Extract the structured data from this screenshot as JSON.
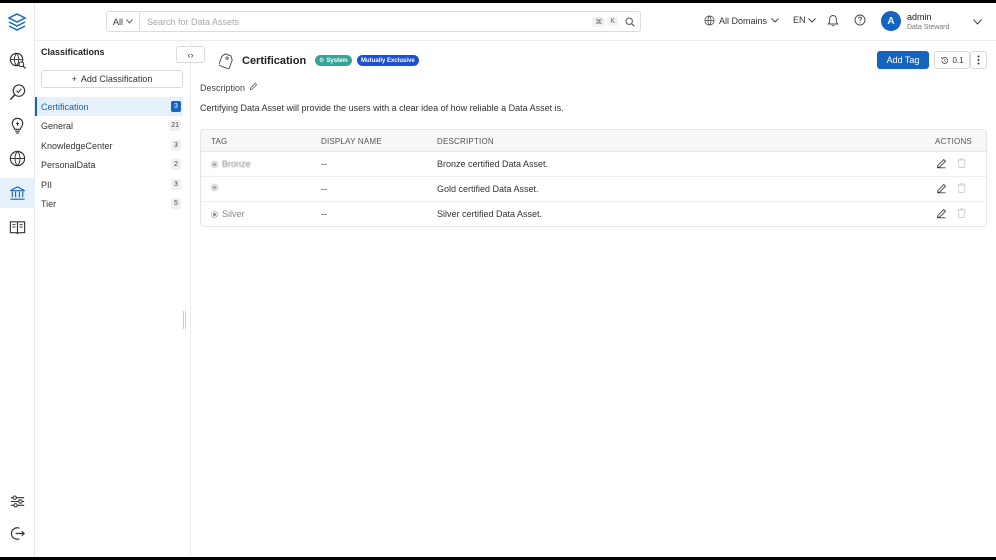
{
  "topbar": {
    "search_scope": "All",
    "search_placeholder": "Search for Data Assets",
    "shortcut_key_1": "⌘",
    "shortcut_key_2": "K",
    "domains_label": "All Domains",
    "language": "EN",
    "user": {
      "initial": "A",
      "name": "admin",
      "role": "Data Steward"
    }
  },
  "panel": {
    "title": "Classifications",
    "add_button": "Add Classification",
    "items": [
      {
        "label": "Certification",
        "count": "3",
        "active": true
      },
      {
        "label": "General",
        "count": "21"
      },
      {
        "label": "KnowledgeCenter",
        "count": "3"
      },
      {
        "label": "PersonalData",
        "count": "2"
      },
      {
        "label": "PII",
        "count": "3"
      },
      {
        "label": "Tier",
        "count": "5"
      }
    ]
  },
  "main": {
    "title": "Certification",
    "badge_system": "System",
    "badge_exclusive": "Mutually Exclusive",
    "add_tag_label": "Add Tag",
    "version": "0.1",
    "description_label": "Description",
    "description_text": "Certifying Data Asset will provide the users with a clear idea of how reliable a Data Asset is.",
    "columns": [
      "TAG",
      "DISPLAY NAME",
      "DESCRIPTION",
      "ACTIONS"
    ],
    "rows": [
      {
        "tag": "Bronze",
        "display_name": "--",
        "description": "Bronze certified Data Asset."
      },
      {
        "tag": "",
        "display_name": "--",
        "description": "Gold certified Data Asset."
      },
      {
        "tag": "Silver",
        "display_name": "--",
        "description": "Silver certified Data Asset."
      }
    ]
  },
  "colors": {
    "primary": "#1565c0",
    "system_badge": "#3aa399",
    "exclusive_badge": "#1d4fd1",
    "active_bg": "#e6f0fb"
  },
  "icons": {
    "rail": [
      "logo-icon",
      "explore-icon",
      "data-quality-icon",
      "insights-icon",
      "domains-icon",
      "governance-icon",
      "glossary-icon",
      "settings-icon",
      "logout-icon"
    ]
  }
}
